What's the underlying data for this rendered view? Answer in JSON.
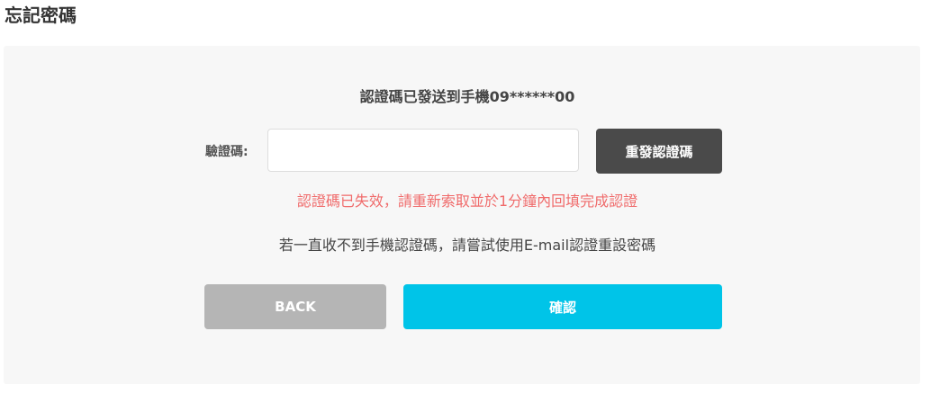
{
  "page": {
    "title": "忘記密碼"
  },
  "form": {
    "sent_message": "認證碼已發送到手機09******00",
    "code_label": "驗證碼:",
    "code_value": "",
    "code_placeholder": "",
    "resend_label": "重發認證碼",
    "error_message": "認證碼已失效，請重新索取並於1分鐘內回填完成認證",
    "hint_message": "若一直收不到手機認證碼，請嘗試使用E-mail認證重設密碼",
    "back_label": "BACK",
    "confirm_label": "確認"
  },
  "colors": {
    "panel_bg": "#f7f7f7",
    "resend_bg": "#4a4a4a",
    "error_text": "#f06b6b",
    "back_bg": "#b5b5b5",
    "confirm_bg": "#00c4e8"
  }
}
